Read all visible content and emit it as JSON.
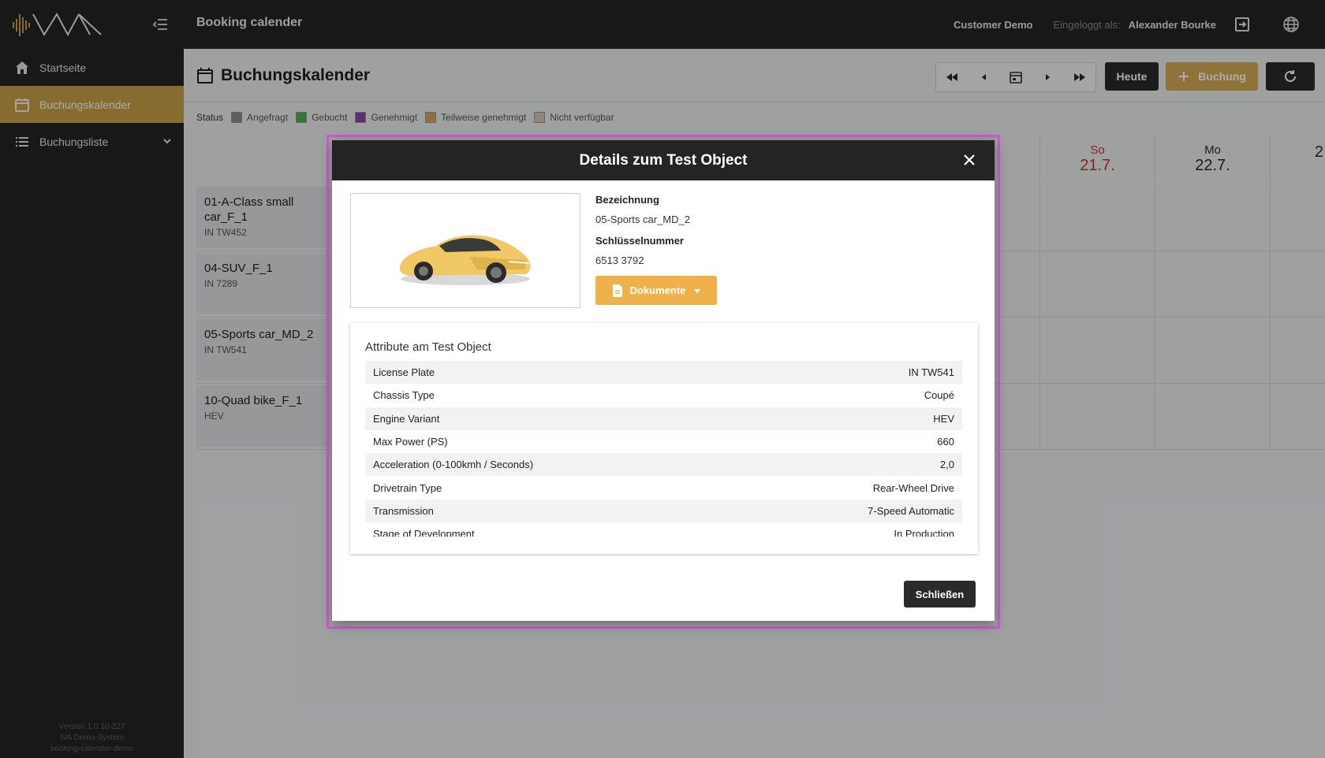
{
  "header": {
    "app_title": "Booking calender",
    "customer": "Customer Demo",
    "logged_in_label": "Eingeloggt als:",
    "user": "Alexander Bourke"
  },
  "sidebar": {
    "items": [
      {
        "label": "Startseite",
        "icon": "home-icon"
      },
      {
        "label": "Buchungskalender",
        "icon": "calendar-icon",
        "active": true
      },
      {
        "label": "Buchungsliste",
        "icon": "list-icon"
      }
    ],
    "version_lines": [
      "Version 1.0.10-227",
      "IVA Demo-System",
      "booking-calendar-demo"
    ]
  },
  "page": {
    "title": "Buchungskalender",
    "heute_label": "Heute",
    "buchung_label": "Buchung"
  },
  "legend": {
    "status_label": "Status",
    "items": [
      {
        "label": "Angefragt",
        "color": "#8c8c8c"
      },
      {
        "label": "Gebucht",
        "color": "#4caf50"
      },
      {
        "label": "Genehmigt",
        "color": "#8e44ad"
      },
      {
        "label": "Teilweise genehmigt",
        "color": "#d4a86a"
      },
      {
        "label": "Nicht verfügbar",
        "color": "#e0c0c0"
      }
    ]
  },
  "calendar": {
    "days": [
      {
        "name": "So",
        "date": "21.7."
      },
      {
        "name": "Mo",
        "date": "22.7."
      },
      {
        "name": "",
        "date": "2"
      }
    ],
    "rows": [
      {
        "name": "01-A-Class small car_F_1",
        "sub": "IN TW452"
      },
      {
        "name": "04-SUV_F_1",
        "sub": "IN 7289"
      },
      {
        "name": "05-Sports car_MD_2",
        "sub": "IN TW541"
      },
      {
        "name": "10-Quad bike_F_1",
        "sub": "HEV"
      }
    ]
  },
  "modal": {
    "title": "Details zum Test Object",
    "bezeichnung_label": "Bezeichnung",
    "bezeichnung_value": "05-Sports car_MD_2",
    "schluessel_label": "Schlüsselnummer",
    "schluessel_value": "6513 3792",
    "docs_label": "Dokumente",
    "attributes_title": "Attribute am Test Object",
    "attributes": [
      {
        "key": "License Plate",
        "value": "IN TW541"
      },
      {
        "key": "Chassis Type",
        "value": "Coupé"
      },
      {
        "key": "Engine Variant",
        "value": "HEV"
      },
      {
        "key": "Max Power (PS)",
        "value": "660"
      },
      {
        "key": "Acceleration (0-100kmh / Seconds)",
        "value": "2,0"
      },
      {
        "key": "Drivetrain Type",
        "value": "Rear-Wheel Drive"
      },
      {
        "key": "Transmission",
        "value": "7-Speed Automatic"
      },
      {
        "key": "Stage of Development",
        "value": "In Production"
      }
    ],
    "close_label": "Schließen"
  }
}
